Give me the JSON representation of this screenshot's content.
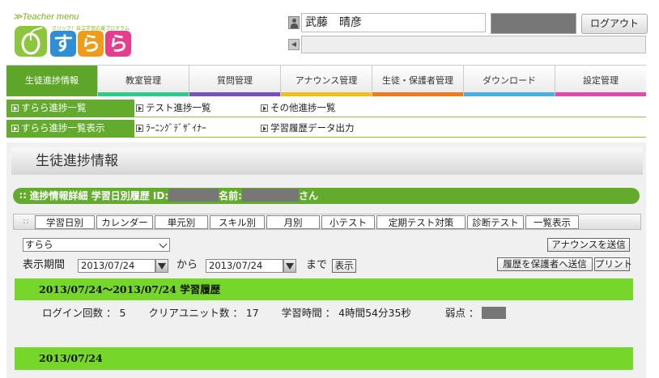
{
  "header": {
    "teacher_menu": "≫Teacher menu",
    "tagline": "クリック！自立学習応援プログラム",
    "logo_kana": [
      "す",
      "ら",
      "ら"
    ],
    "user_name": "武藤　晴彦",
    "logout_label": "ログアウト"
  },
  "colors": {
    "accent_green": "#62ab2c",
    "bright_green": "#77d62a",
    "nav_bar_colors": [
      "#5ea62a",
      "#2ecc8a",
      "#7a4fc0",
      "#f0c020",
      "#f07a20",
      "#4ab0e0",
      "#e04aa8"
    ]
  },
  "main_nav": [
    {
      "label": "生徒進捗情報"
    },
    {
      "label": "教室管理"
    },
    {
      "label": "質問管理"
    },
    {
      "label": "アナウンス管理"
    },
    {
      "label": "生徒・保護者管理"
    },
    {
      "label": "ダウンロード"
    },
    {
      "label": "設定管理"
    }
  ],
  "sub_nav_row1": [
    {
      "label": "すらら進捗一覧"
    },
    {
      "label": "テスト進捗一覧"
    },
    {
      "label": "その他進捗一覧"
    }
  ],
  "sub_nav_row2": [
    {
      "label": "すらら進捗一覧表示"
    },
    {
      "label": "ﾗｰﾆﾝｸﾞﾃﾞｻﾞｲﾅｰ"
    },
    {
      "label": "学習履歴データ出力"
    }
  ],
  "page_title": "生徒進捗情報",
  "detail_bar": {
    "prefix": "進捗情報詳細 学習日別履歴 ID:",
    "name_label": "名前:",
    "suffix": "さん"
  },
  "tabs": [
    {
      "label": "学習日別"
    },
    {
      "label": "カレンダー"
    },
    {
      "label": "単元別"
    },
    {
      "label": "スキル別"
    },
    {
      "label": "月別"
    },
    {
      "label": "小テスト"
    },
    {
      "label": "定期テスト対策"
    },
    {
      "label": "診断テスト"
    },
    {
      "label": "一覧表示"
    }
  ],
  "filters": {
    "course_select": "すらら",
    "announce_button": "アナウンスを送信",
    "period_label": "表示期間",
    "date_from": "2013/07/24",
    "from_word": "から",
    "date_to": "2013/07/24",
    "until_word": "まで",
    "show_button": "表示",
    "send_history_button": "履歴を保護者へ送信",
    "print_button": "プリント"
  },
  "history": {
    "range_title": "2013/07/24～2013/07/24 学習履歴",
    "login_label": "ログイン回数 ： 5",
    "clear_label": "クリアユニット数 ： 17",
    "time_label": "学習時間 ： 4時間54分35秒",
    "weak_label": "弱点 ："
  },
  "date_section": "2013/07/24"
}
